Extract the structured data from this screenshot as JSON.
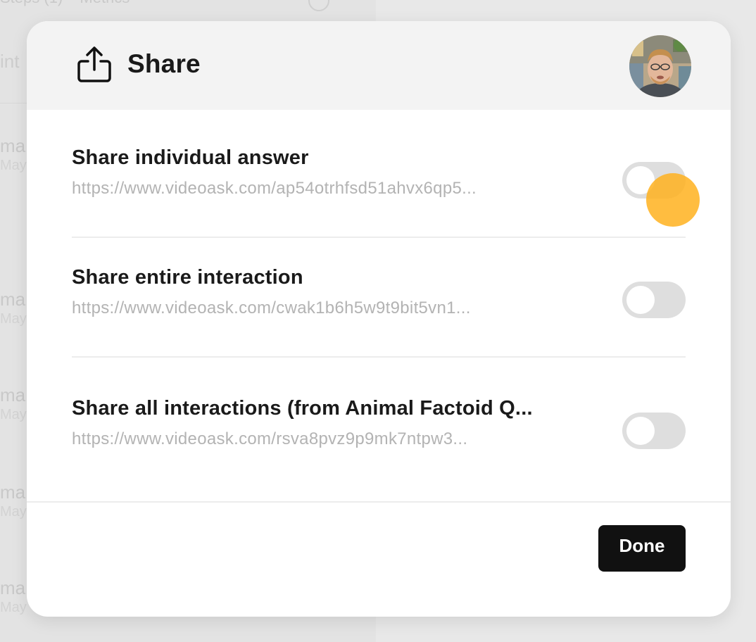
{
  "background": {
    "tabs": [
      "Steps (1)",
      "Metrics"
    ],
    "interactions_label": "int",
    "rows": [
      {
        "name": "ma",
        "date": "May"
      },
      {
        "name": "ma",
        "date": "May"
      },
      {
        "name": "ma",
        "date": "May"
      },
      {
        "name": "ma",
        "date": "May"
      },
      {
        "name": "ma",
        "date": "May"
      }
    ]
  },
  "modal": {
    "title": "Share",
    "header_icon": "share-icon",
    "options": [
      {
        "title": "Share individual answer",
        "url": "https://www.videoask.com/ap54otrhfsd51ahvx6qp5...",
        "enabled": false
      },
      {
        "title": "Share entire interaction",
        "url": "https://www.videoask.com/cwak1b6h5w9t9bit5vn1...",
        "enabled": false
      },
      {
        "title": "Share all interactions (from Animal Factoid Q...",
        "url": "https://www.videoask.com/rsva8pvz9p9mk7ntpw3...",
        "enabled": false
      }
    ],
    "done_label": "Done"
  },
  "colors": {
    "button_bg": "#111111",
    "toggle_off": "#dedede",
    "cursor_highlight": "#ffb21e",
    "url_text": "#b3b3b3"
  }
}
